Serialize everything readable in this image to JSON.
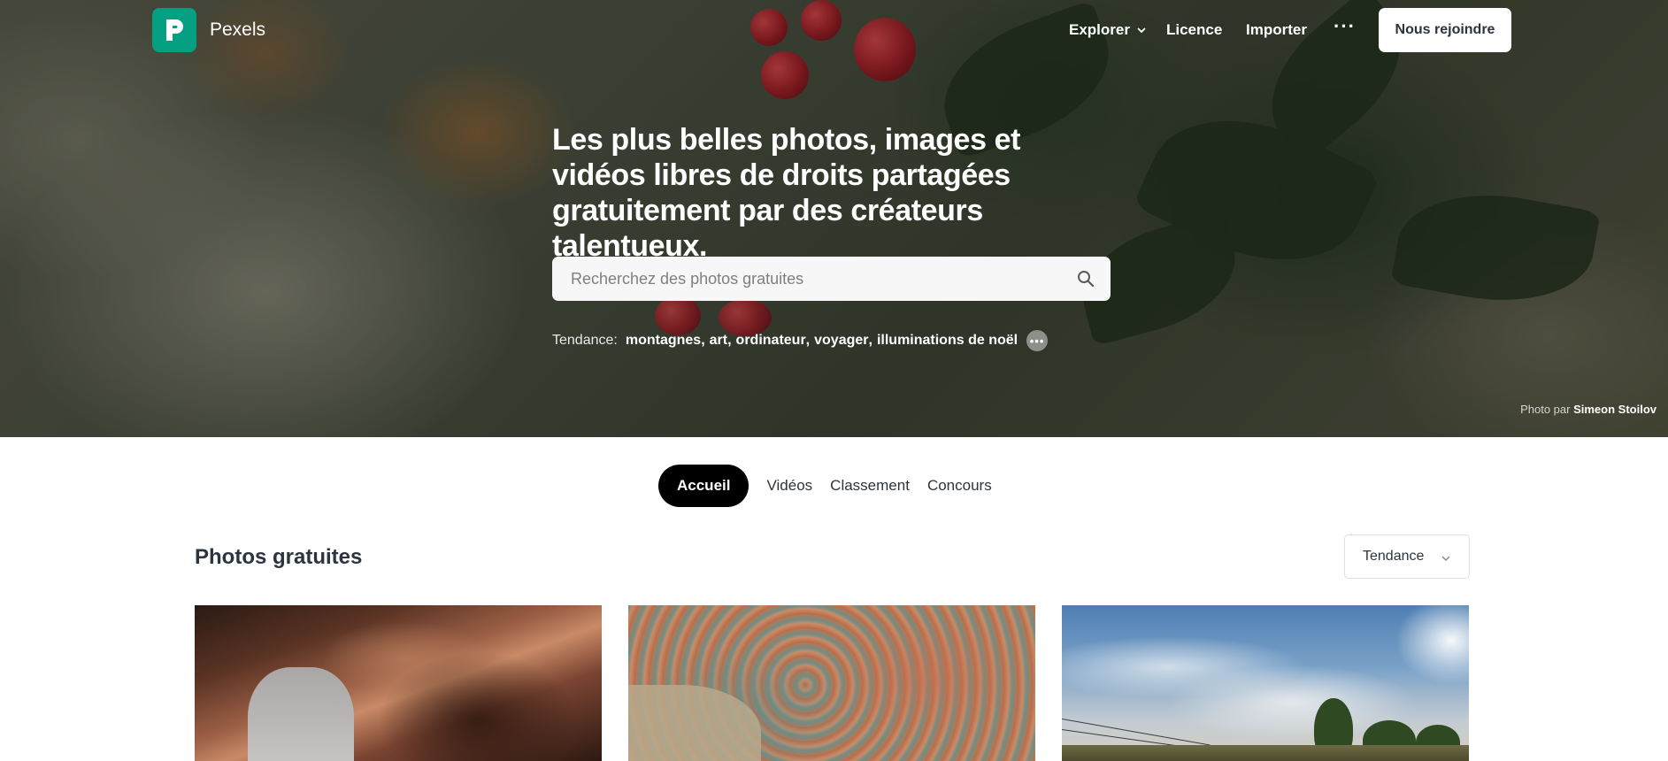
{
  "header": {
    "brand": "Pexels",
    "nav": {
      "explore": "Explorer",
      "licence": "Licence",
      "upload": "Importer",
      "more": "···",
      "join": "Nous rejoindre"
    }
  },
  "hero": {
    "headline": "Les plus belles photos, images et vidéos libres de droits partagées gratuitement par des créateurs talentueux.",
    "search": {
      "placeholder": "Recherchez des photos gratuites",
      "value": ""
    },
    "trending": {
      "label": "Tendance:",
      "items": [
        "montagnes",
        "art",
        "ordinateur",
        "voyager",
        "illuminations de noël"
      ],
      "more": "•••"
    },
    "credit": {
      "prefix": "Photo par",
      "author": "Simeon Stoilov"
    }
  },
  "tabs": [
    "Accueil",
    "Vidéos",
    "Classement",
    "Concours"
  ],
  "section": {
    "title": "Photos gratuites",
    "sort": "Tendance"
  },
  "colors": {
    "brand": "#05a081",
    "active_tab": "#000000",
    "text": "#2c343e"
  },
  "icons": {
    "logo": "pexels-logo-icon",
    "search": "search-icon",
    "chevron": "chevron-down-icon",
    "more": "more-dots-icon"
  }
}
